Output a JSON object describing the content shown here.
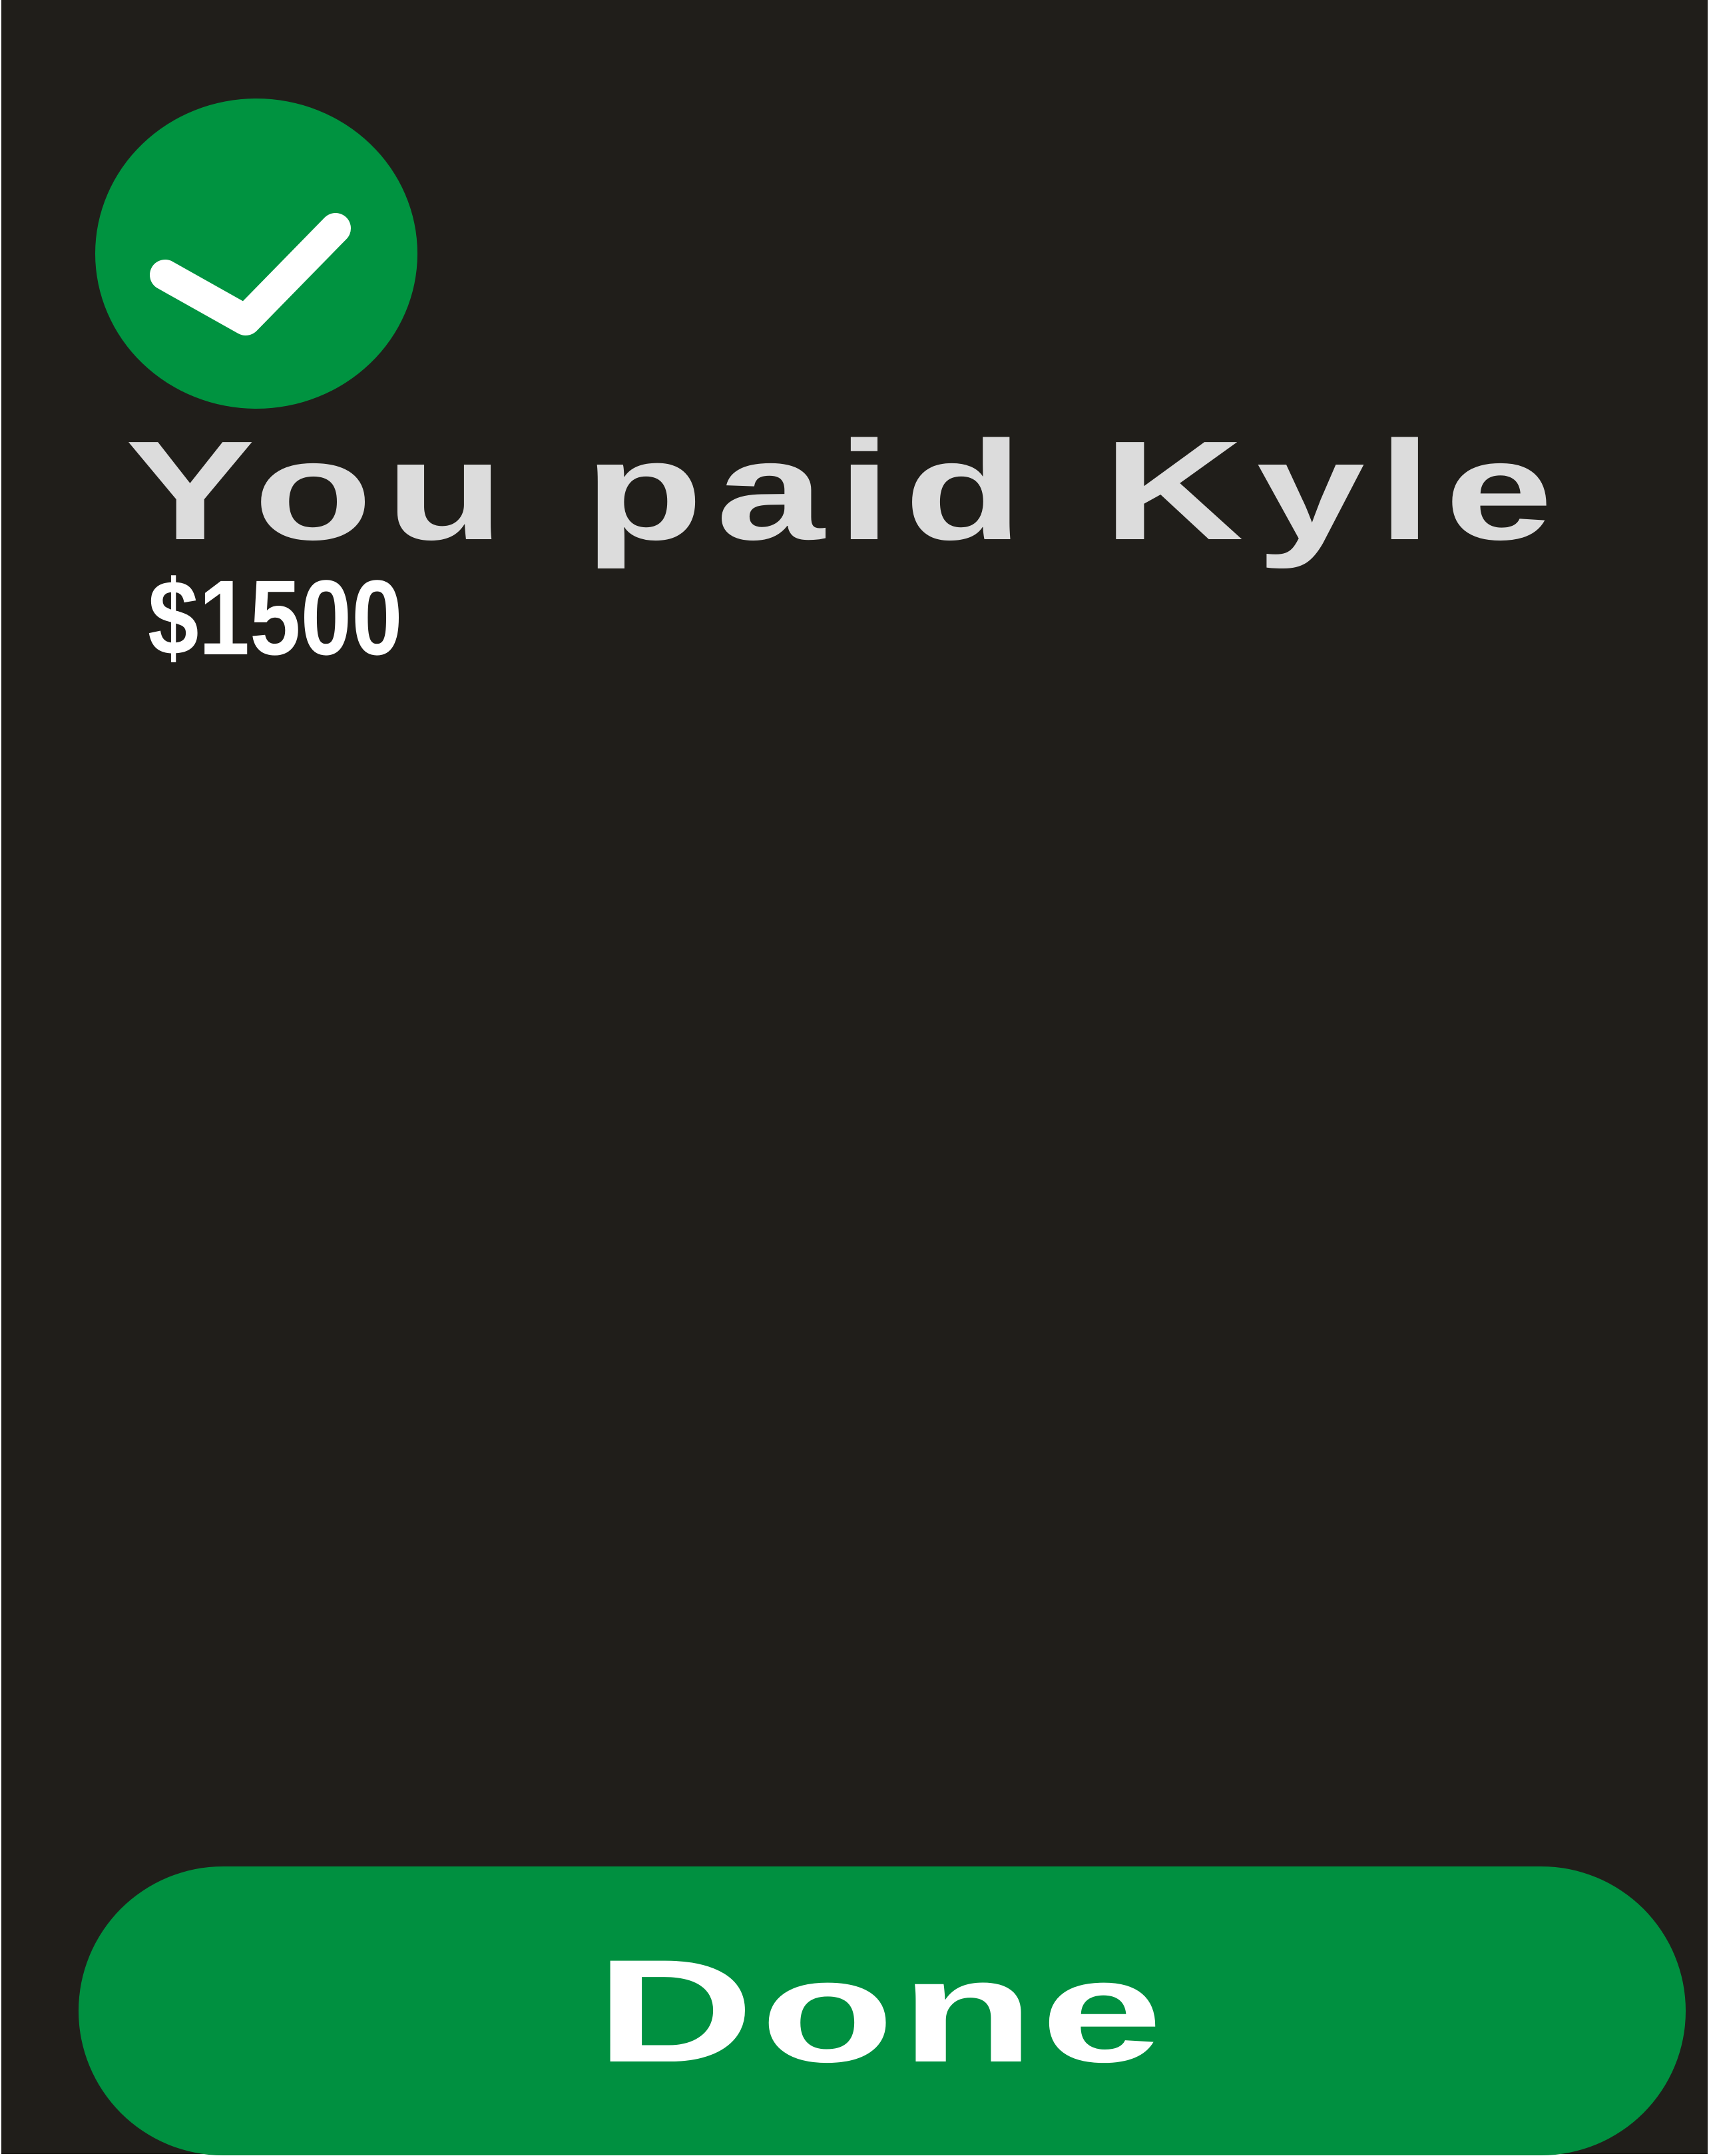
{
  "theme": {
    "background": "#201e1a",
    "accent": "#009340",
    "title_color": "#dcdcdc",
    "text_color": "#ffffff"
  },
  "status": {
    "icon": "checkmark-icon",
    "title": "You paid Kyle",
    "amount": "$1500"
  },
  "actions": {
    "done_label": "Done"
  }
}
